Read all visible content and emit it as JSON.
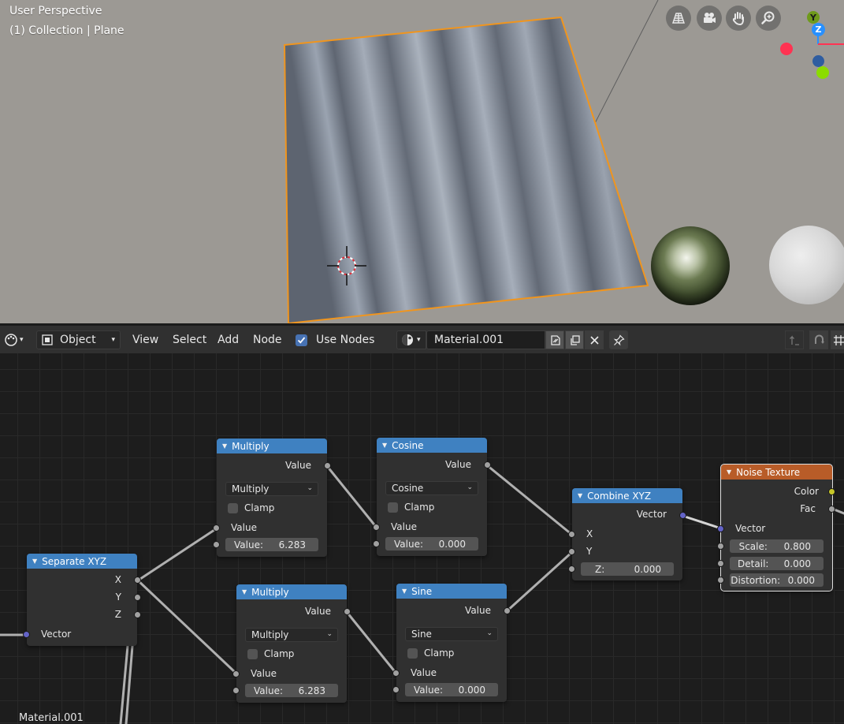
{
  "viewport": {
    "perspective_label": "User Perspective",
    "collection_label": "(1) Collection | Plane",
    "nav_buttons": [
      {
        "icon": "grid-toggle-icon"
      },
      {
        "icon": "camera-icon"
      },
      {
        "icon": "hand-pan-icon"
      },
      {
        "icon": "zoom-icon"
      }
    ],
    "gizmo": {
      "y_label": "Y",
      "z_label": "Z"
    },
    "colors": {
      "selection_outline": "#f0951e",
      "axis_x": "#ff3352",
      "axis_y": "#8bdc00",
      "axis_z": "#2890ff"
    }
  },
  "header": {
    "mode_label": "Object",
    "menus": [
      "View",
      "Select",
      "Add",
      "Node"
    ],
    "use_nodes_label": "Use Nodes",
    "use_nodes_checked": true,
    "material_name": "Material.001"
  },
  "nodes": {
    "multiply1": {
      "title": "Multiply",
      "output": "Value",
      "operation": "Multiply",
      "clamp_label": "Clamp",
      "input_label": "Value",
      "field_label": "Value:",
      "field_value": "6.283"
    },
    "cosine": {
      "title": "Cosine",
      "output": "Value",
      "operation": "Cosine",
      "clamp_label": "Clamp",
      "input_label": "Value",
      "field_label": "Value:",
      "field_value": "0.000"
    },
    "multiply2": {
      "title": "Multiply",
      "output": "Value",
      "operation": "Multiply",
      "clamp_label": "Clamp",
      "input_label": "Value",
      "field_label": "Value:",
      "field_value": "6.283"
    },
    "sine": {
      "title": "Sine",
      "output": "Value",
      "operation": "Sine",
      "clamp_label": "Clamp",
      "input_label": "Value",
      "field_label": "Value:",
      "field_value": "0.000"
    },
    "separate": {
      "title": "Separate XYZ",
      "out_x": "X",
      "out_y": "Y",
      "out_z": "Z",
      "input": "Vector"
    },
    "combine": {
      "title": "Combine XYZ",
      "output": "Vector",
      "in_x": "X",
      "in_y": "Y",
      "z_label": "Z:",
      "z_value": "0.000"
    },
    "noise": {
      "title": "Noise Texture",
      "out_color": "Color",
      "out_fac": "Fac",
      "input": "Vector",
      "scale_label": "Scale:",
      "scale_value": "0.800",
      "detail_label": "Detail:",
      "detail_value": "0.000",
      "distortion_label": "Distortion:",
      "distortion_value": "0.000"
    }
  },
  "editor_footer_label": "Material.001",
  "colors": {
    "math_header": "#3f81c1",
    "texture_header": "#b85c28",
    "header_bg": "#303030",
    "checkbox": "#4772b3"
  }
}
